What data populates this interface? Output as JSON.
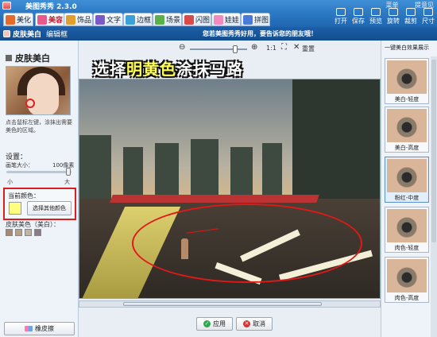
{
  "app": {
    "title": "美图秀秀 2.3.0",
    "top_links": [
      "菜单",
      "提意见"
    ]
  },
  "tabs": [
    {
      "label": "美化",
      "color": "#e66a2c"
    },
    {
      "label": "美容",
      "color": "#e85a8c"
    },
    {
      "label": "饰品",
      "color": "#e0a030"
    },
    {
      "label": "文字",
      "color": "#7a5ac8"
    },
    {
      "label": "边框",
      "color": "#3aa0d8"
    },
    {
      "label": "场景",
      "color": "#5bb04a"
    },
    {
      "label": "闪图",
      "color": "#d94a4a"
    },
    {
      "label": "娃娃",
      "color": "#f08abf"
    },
    {
      "label": "拼图",
      "color": "#4a7ad8"
    }
  ],
  "tools": [
    "打开",
    "保存",
    "预览",
    "旋转",
    "裁剪",
    "尺寸"
  ],
  "subbar": {
    "title": "皮肤美白",
    "edit": "编辑框",
    "message": "您若美图秀秀好用，要告诉您的朋友哦！"
  },
  "left_panel": {
    "heading": "皮肤美白",
    "tip": "点击鼠标左键，涂抹出需要美色的区域。",
    "settings_label": "设置：",
    "brush_size_label": "画笔大小：",
    "brush_size_value": "100像素",
    "min_label": "小",
    "max_label": "大",
    "current_color_label": "当前颜色：",
    "other_color_button": "选择其他颜色",
    "skin_colors_label": "皮肤美色（美白）：",
    "skin_swatches": [
      "#a88a72",
      "#b7a088",
      "#c1b3a6",
      "#8b7a88"
    ],
    "current_color": "#ffff80",
    "eraser_button": "橡皮擦"
  },
  "canvas": {
    "zoom_ratio": "1:1",
    "reset_label": "重置",
    "overlay_text_parts": [
      "选择",
      "明黄色",
      "涂抹马路"
    ],
    "apply_button": "应用",
    "cancel_button": "取消"
  },
  "right_panel": {
    "heading": "一键美白效果展示",
    "effects": [
      "美白-轻度",
      "美白-高度",
      "粉红-中度",
      "肉色-轻度",
      "肉色-高度"
    ],
    "selected_index": 2
  }
}
